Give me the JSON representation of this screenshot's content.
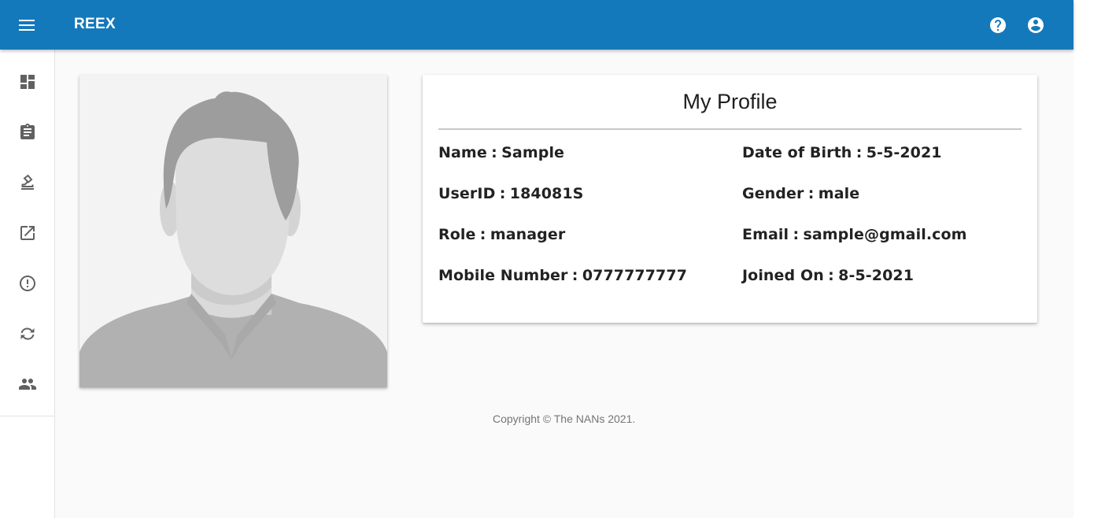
{
  "app": {
    "title": "REEX"
  },
  "sidebar": {
    "items": [
      {
        "name": "dashboard",
        "icon": "dashboard-icon"
      },
      {
        "name": "assignment",
        "icon": "clipboard-icon"
      },
      {
        "name": "evaluate",
        "icon": "stamp-icon"
      },
      {
        "name": "open",
        "icon": "open-in-new-icon"
      },
      {
        "name": "alerts",
        "icon": "error-outline-icon"
      },
      {
        "name": "sync",
        "icon": "sync-icon"
      },
      {
        "name": "people",
        "icon": "people-icon"
      }
    ]
  },
  "header": {
    "help_icon": "help-icon",
    "account_icon": "account-circle-icon"
  },
  "profile": {
    "title": "My Profile",
    "name": {
      "label": "Name",
      "value": "Sample"
    },
    "user_id": {
      "label": "UserID",
      "value": "184081S"
    },
    "role": {
      "label": "Role",
      "value": "manager"
    },
    "mobile": {
      "label": "Mobile Number",
      "value": "0777777777"
    },
    "dob": {
      "label": "Date of Birth",
      "value": "5-5-2021"
    },
    "gender": {
      "label": "Gender",
      "value": "male"
    },
    "email": {
      "label": "Email",
      "value": "sample@gmail.com"
    },
    "joined": {
      "label": "Joined On",
      "value": "8-5-2021"
    }
  },
  "footer": {
    "copyright": "Copyright © The NANs 2021."
  },
  "colors": {
    "appbar": "#1479bb",
    "icon": "#616161",
    "avatar_bg": "#f3f3f3"
  }
}
